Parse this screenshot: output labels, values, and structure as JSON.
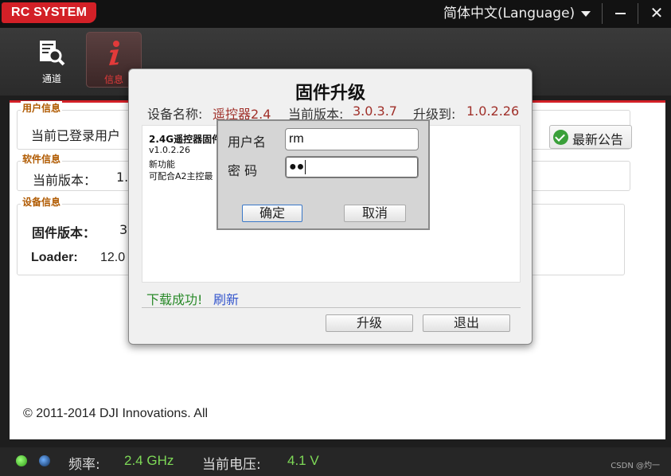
{
  "app": {
    "logo": "RC SYSTEM",
    "language": "简体中文(Language)",
    "close_glyph": "✕"
  },
  "toolbar": {
    "items": [
      {
        "label": "通道"
      },
      {
        "label": "信息"
      }
    ]
  },
  "user_info": {
    "title": "用户信息",
    "text": "当前已登录用户",
    "notice_button": "最新公告"
  },
  "software_info": {
    "title": "软件信息",
    "version_label": "当前版本：",
    "version_value": "1.;"
  },
  "device_info": {
    "title": "设备信息",
    "firmware_label": "固件版本：",
    "firmware_value": "3",
    "loader_label": "Loader:",
    "loader_value": "12.0"
  },
  "footer": {
    "copyright": "© 2011-2014 DJI Innovations. All"
  },
  "status": {
    "freq_label": "频率:",
    "freq_value": "2.4 GHz",
    "voltage_label": "当前电压:",
    "voltage_value": "4.1 V",
    "watermark": "CSDN @灼一"
  },
  "firmware_dialog": {
    "title": "固件升级",
    "device_label": "设备名称:",
    "device_value": "遥控器2.4",
    "current_label": "当前版本:",
    "current_value": "3.0.3.7",
    "upgrade_label": "升级到:",
    "upgrade_value": "1.0.2.26",
    "notes": [
      "2.4G遥控器固件",
      "v1.0.2.26",
      "新功能",
      "可配合A2主控最"
    ],
    "download_status": "下载成功!",
    "refresh_link": "刷新",
    "upgrade_button": "升级",
    "exit_button": "退出"
  },
  "login_dialog": {
    "username_label": "用户名",
    "username_value": "rm",
    "password_label": "密  码",
    "password_value": "●●",
    "ok_button": "确定",
    "cancel_button": "取消"
  },
  "colors": {
    "accent": "#d32027",
    "status_value": "#7ed957",
    "version_value": "#a0302a"
  }
}
